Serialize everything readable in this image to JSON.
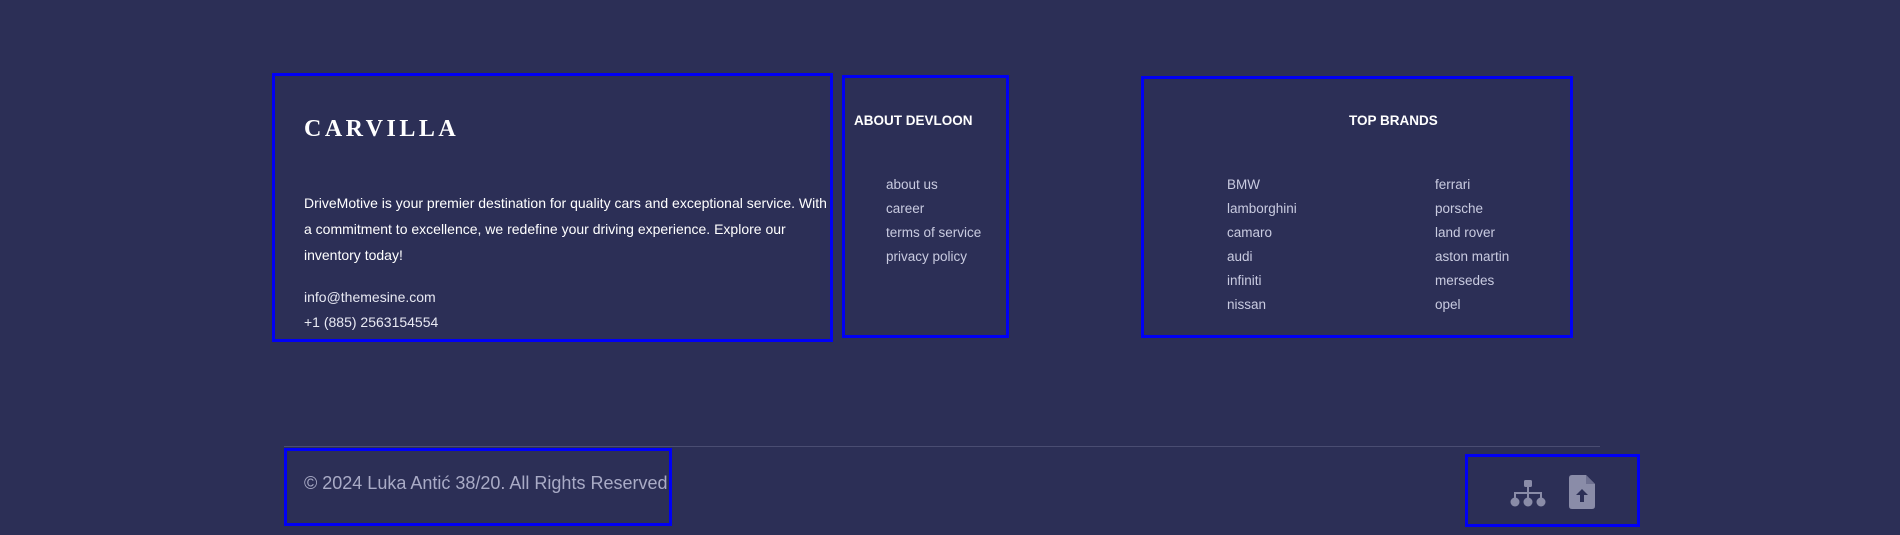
{
  "brand": {
    "logo": "CARVILLA",
    "description": "DriveMotive is your premier destination for quality cars and exceptional service. With a commitment to excellence, we redefine your driving experience. Explore our inventory today!",
    "email": "info@themesine.com",
    "phone": "+1 (885) 2563154554"
  },
  "about": {
    "title": "ABOUT DEVLOON",
    "links": [
      "about us",
      "career",
      "terms of service",
      "privacy policy"
    ]
  },
  "brands": {
    "title": "TOP BRANDS",
    "left": [
      "BMW",
      "lamborghini",
      "camaro",
      "audi",
      "infiniti",
      "nissan"
    ],
    "right": [
      "ferrari",
      "porsche",
      "land rover",
      "aston martin",
      "mersedes",
      "opel"
    ]
  },
  "footer": {
    "copyright": "© 2024 Luka Antić 38/20. All Rights Reserved",
    "icons": [
      "sitemap-icon",
      "file-upload-icon"
    ]
  },
  "colors": {
    "background": "#2c2f56",
    "outline": "#0000f5",
    "link": "#c9cbe0",
    "icon": "#8a8ca8"
  }
}
